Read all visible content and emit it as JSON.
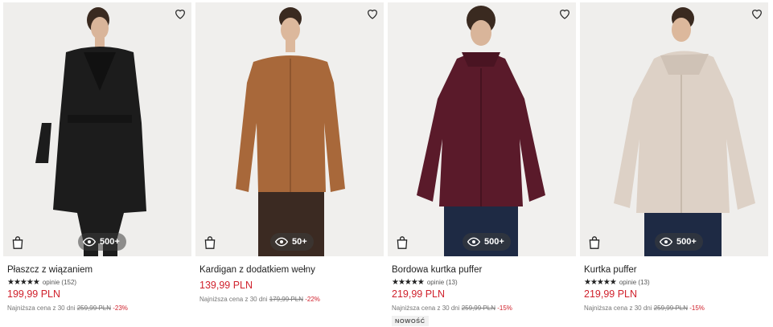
{
  "products": [
    {
      "title": "Płaszcz z wiązaniem",
      "rating_text": "opinie (152)",
      "price": "199,99 PLN",
      "lowest_label": "Najniższa cena z 30 dni",
      "old_price": "259,99 PLN",
      "discount": "-23%",
      "views": "500+",
      "badge": "",
      "colors": {
        "bg": "#efeeec",
        "garment": "#1c1c1c",
        "pants": "#1c1c1c"
      }
    },
    {
      "title": "Kardigan z dodatkiem wełny",
      "rating_text": "",
      "price": "139,99 PLN",
      "lowest_label": "Najniższa cena z 30 dni",
      "old_price": "179,99 PLN",
      "discount": "-22%",
      "views": "50+",
      "badge": "",
      "colors": {
        "bg": "#f0efed",
        "garment": "#a8683a",
        "pants": "#3b2a22"
      }
    },
    {
      "title": "Bordowa kurtka puffer",
      "rating_text": "opinie (13)",
      "price": "219,99 PLN",
      "lowest_label": "Najniższa cena z 30 dni",
      "old_price": "259,99 PLN",
      "discount": "-15%",
      "views": "500+",
      "badge": "NOWOŚĆ",
      "colors": {
        "bg": "#f1f0ee",
        "garment": "#5a1a2a",
        "pants": "#1e2a44"
      }
    },
    {
      "title": "Kurtka puffer",
      "rating_text": "opinie (13)",
      "price": "219,99 PLN",
      "lowest_label": "Najniższa cena z 30 dni",
      "old_price": "259,99 PLN",
      "discount": "-15%",
      "views": "500+",
      "badge": "",
      "colors": {
        "bg": "#efeeec",
        "garment": "#ddd1c6",
        "pants": "#1e2a44"
      }
    }
  ],
  "stars": "★★★★★"
}
